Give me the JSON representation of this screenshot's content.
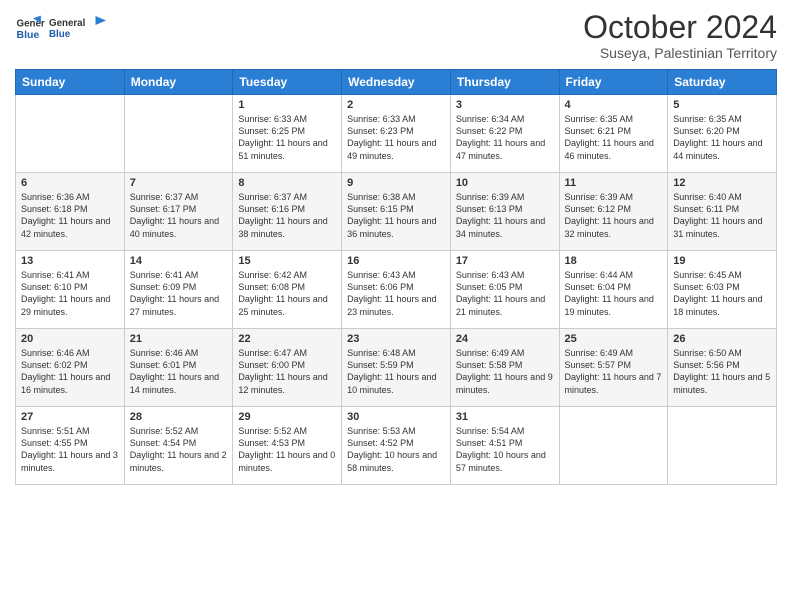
{
  "logo": {
    "line1": "General",
    "line2": "Blue"
  },
  "title": "October 2024",
  "subtitle": "Suseya, Palestinian Territory",
  "days_of_week": [
    "Sunday",
    "Monday",
    "Tuesday",
    "Wednesday",
    "Thursday",
    "Friday",
    "Saturday"
  ],
  "weeks": [
    [
      {
        "day": "",
        "info": ""
      },
      {
        "day": "",
        "info": ""
      },
      {
        "day": "1",
        "info": "Sunrise: 6:33 AM\nSunset: 6:25 PM\nDaylight: 11 hours and 51 minutes."
      },
      {
        "day": "2",
        "info": "Sunrise: 6:33 AM\nSunset: 6:23 PM\nDaylight: 11 hours and 49 minutes."
      },
      {
        "day": "3",
        "info": "Sunrise: 6:34 AM\nSunset: 6:22 PM\nDaylight: 11 hours and 47 minutes."
      },
      {
        "day": "4",
        "info": "Sunrise: 6:35 AM\nSunset: 6:21 PM\nDaylight: 11 hours and 46 minutes."
      },
      {
        "day": "5",
        "info": "Sunrise: 6:35 AM\nSunset: 6:20 PM\nDaylight: 11 hours and 44 minutes."
      }
    ],
    [
      {
        "day": "6",
        "info": "Sunrise: 6:36 AM\nSunset: 6:18 PM\nDaylight: 11 hours and 42 minutes."
      },
      {
        "day": "7",
        "info": "Sunrise: 6:37 AM\nSunset: 6:17 PM\nDaylight: 11 hours and 40 minutes."
      },
      {
        "day": "8",
        "info": "Sunrise: 6:37 AM\nSunset: 6:16 PM\nDaylight: 11 hours and 38 minutes."
      },
      {
        "day": "9",
        "info": "Sunrise: 6:38 AM\nSunset: 6:15 PM\nDaylight: 11 hours and 36 minutes."
      },
      {
        "day": "10",
        "info": "Sunrise: 6:39 AM\nSunset: 6:13 PM\nDaylight: 11 hours and 34 minutes."
      },
      {
        "day": "11",
        "info": "Sunrise: 6:39 AM\nSunset: 6:12 PM\nDaylight: 11 hours and 32 minutes."
      },
      {
        "day": "12",
        "info": "Sunrise: 6:40 AM\nSunset: 6:11 PM\nDaylight: 11 hours and 31 minutes."
      }
    ],
    [
      {
        "day": "13",
        "info": "Sunrise: 6:41 AM\nSunset: 6:10 PM\nDaylight: 11 hours and 29 minutes."
      },
      {
        "day": "14",
        "info": "Sunrise: 6:41 AM\nSunset: 6:09 PM\nDaylight: 11 hours and 27 minutes."
      },
      {
        "day": "15",
        "info": "Sunrise: 6:42 AM\nSunset: 6:08 PM\nDaylight: 11 hours and 25 minutes."
      },
      {
        "day": "16",
        "info": "Sunrise: 6:43 AM\nSunset: 6:06 PM\nDaylight: 11 hours and 23 minutes."
      },
      {
        "day": "17",
        "info": "Sunrise: 6:43 AM\nSunset: 6:05 PM\nDaylight: 11 hours and 21 minutes."
      },
      {
        "day": "18",
        "info": "Sunrise: 6:44 AM\nSunset: 6:04 PM\nDaylight: 11 hours and 19 minutes."
      },
      {
        "day": "19",
        "info": "Sunrise: 6:45 AM\nSunset: 6:03 PM\nDaylight: 11 hours and 18 minutes."
      }
    ],
    [
      {
        "day": "20",
        "info": "Sunrise: 6:46 AM\nSunset: 6:02 PM\nDaylight: 11 hours and 16 minutes."
      },
      {
        "day": "21",
        "info": "Sunrise: 6:46 AM\nSunset: 6:01 PM\nDaylight: 11 hours and 14 minutes."
      },
      {
        "day": "22",
        "info": "Sunrise: 6:47 AM\nSunset: 6:00 PM\nDaylight: 11 hours and 12 minutes."
      },
      {
        "day": "23",
        "info": "Sunrise: 6:48 AM\nSunset: 5:59 PM\nDaylight: 11 hours and 10 minutes."
      },
      {
        "day": "24",
        "info": "Sunrise: 6:49 AM\nSunset: 5:58 PM\nDaylight: 11 hours and 9 minutes."
      },
      {
        "day": "25",
        "info": "Sunrise: 6:49 AM\nSunset: 5:57 PM\nDaylight: 11 hours and 7 minutes."
      },
      {
        "day": "26",
        "info": "Sunrise: 6:50 AM\nSunset: 5:56 PM\nDaylight: 11 hours and 5 minutes."
      }
    ],
    [
      {
        "day": "27",
        "info": "Sunrise: 5:51 AM\nSunset: 4:55 PM\nDaylight: 11 hours and 3 minutes."
      },
      {
        "day": "28",
        "info": "Sunrise: 5:52 AM\nSunset: 4:54 PM\nDaylight: 11 hours and 2 minutes."
      },
      {
        "day": "29",
        "info": "Sunrise: 5:52 AM\nSunset: 4:53 PM\nDaylight: 11 hours and 0 minutes."
      },
      {
        "day": "30",
        "info": "Sunrise: 5:53 AM\nSunset: 4:52 PM\nDaylight: 10 hours and 58 minutes."
      },
      {
        "day": "31",
        "info": "Sunrise: 5:54 AM\nSunset: 4:51 PM\nDaylight: 10 hours and 57 minutes."
      },
      {
        "day": "",
        "info": ""
      },
      {
        "day": "",
        "info": ""
      }
    ]
  ]
}
